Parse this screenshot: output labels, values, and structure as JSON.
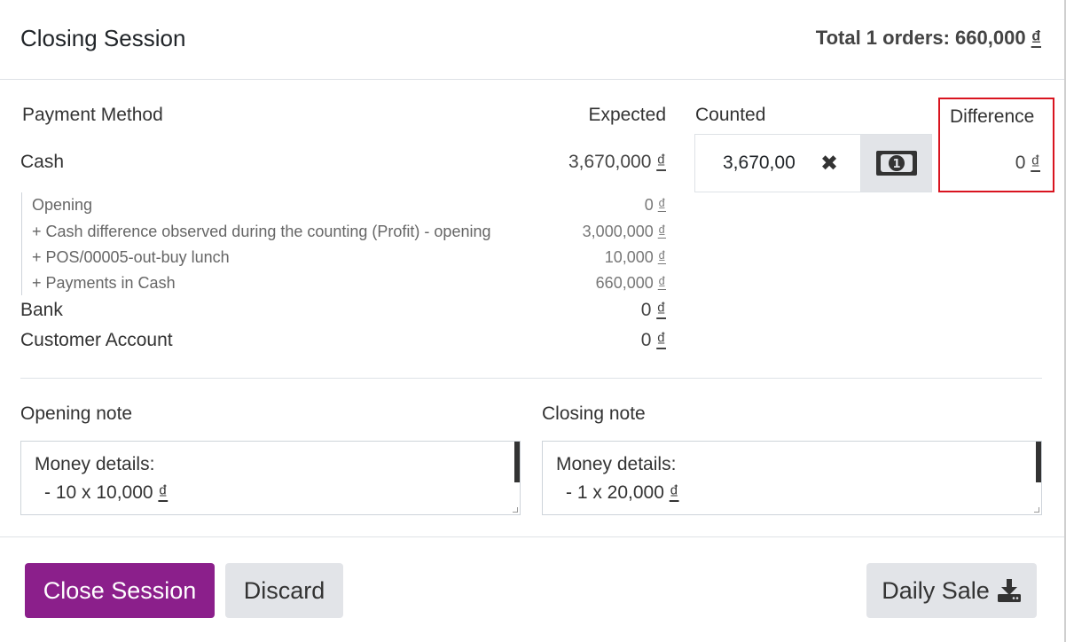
{
  "header": {
    "title": "Closing Session",
    "total_prefix": "Total 1 orders: 660,000 ",
    "total_currency": "₫"
  },
  "columns": {
    "payment_method": "Payment Method",
    "expected": "Expected",
    "counted": "Counted",
    "difference": "Difference"
  },
  "cash": {
    "label": "Cash",
    "expected_amount": "3,670,000 ",
    "currency": "₫",
    "counted_value": "3,670,00",
    "difference_amount": "0 ",
    "details": [
      {
        "label": "Opening",
        "amount": "0 "
      },
      {
        "label": "+ Cash difference observed during the counting (Profit) - opening",
        "amount": "3,000,000 "
      },
      {
        "label": "+ POS/00005-out-buy lunch",
        "amount": "10,000 "
      },
      {
        "label": "+ Payments in Cash",
        "amount": "660,000 "
      }
    ]
  },
  "bank": {
    "label": "Bank",
    "amount": "0 "
  },
  "customer_account": {
    "label": "Customer Account",
    "amount": "0 "
  },
  "opening_note": {
    "label": "Opening note",
    "line1": "Money details:",
    "line2": "- 10 x 10,000 "
  },
  "closing_note": {
    "label": "Closing note",
    "line1": "Money details:",
    "line2": "- 1 x 20,000 "
  },
  "buttons": {
    "close_session": "Close Session",
    "discard": "Discard",
    "daily_sale": "Daily Sale"
  },
  "icons": {
    "clear": "times-icon",
    "money": "money-bill-icon",
    "download": "download-icon"
  },
  "colors": {
    "primary": "#8b1f8b",
    "highlight_border": "#d9141f",
    "secondary_button": "#e2e4e8"
  }
}
